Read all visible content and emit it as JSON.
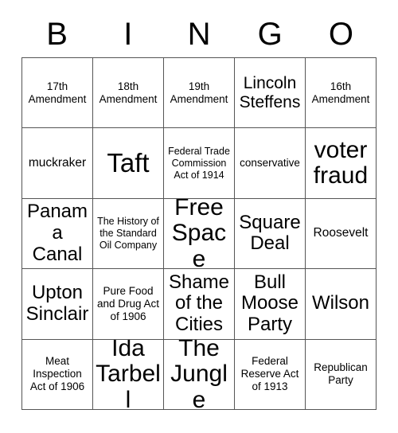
{
  "card": {
    "title": "BINGO",
    "header_letters": [
      "B",
      "I",
      "N",
      "G",
      "O"
    ],
    "rows": 5,
    "columns": 5,
    "border_color": "#555555",
    "text_color": "#000000",
    "background_color": "#ffffff",
    "cells": [
      {
        "text": "17th Amendment",
        "size": "s"
      },
      {
        "text": "18th Amendment",
        "size": "s"
      },
      {
        "text": "19th Amendment",
        "size": "s"
      },
      {
        "text": "Lincoln Steffens",
        "size": "l"
      },
      {
        "text": "16th Amendment",
        "size": "s"
      },
      {
        "text": "muckraker",
        "size": "m"
      },
      {
        "text": "Taft",
        "size": "huge"
      },
      {
        "text": "Federal Trade Commission Act of 1914",
        "size": "xs"
      },
      {
        "text": "conservative",
        "size": "s"
      },
      {
        "text": "voter fraud",
        "size": "xxl"
      },
      {
        "text": "Panama Canal",
        "size": "xl"
      },
      {
        "text": "The History of the Standard Oil Company",
        "size": "xs"
      },
      {
        "text": "Free Space",
        "size": "xxl"
      },
      {
        "text": "Square Deal",
        "size": "xl"
      },
      {
        "text": "Roosevelt",
        "size": "m"
      },
      {
        "text": "Upton Sinclair",
        "size": "xl"
      },
      {
        "text": "Pure Food and Drug Act of 1906",
        "size": "s"
      },
      {
        "text": "Shame of the Cities",
        "size": "xl"
      },
      {
        "text": "Bull Moose Party",
        "size": "xl"
      },
      {
        "text": "Wilson",
        "size": "xl"
      },
      {
        "text": "Meat Inspection Act of 1906",
        "size": "s"
      },
      {
        "text": "Ida Tarbell",
        "size": "xxl"
      },
      {
        "text": "The Jungle",
        "size": "xxl"
      },
      {
        "text": "Federal Reserve Act of 1913",
        "size": "s"
      },
      {
        "text": "Republican Party",
        "size": "s"
      }
    ]
  }
}
